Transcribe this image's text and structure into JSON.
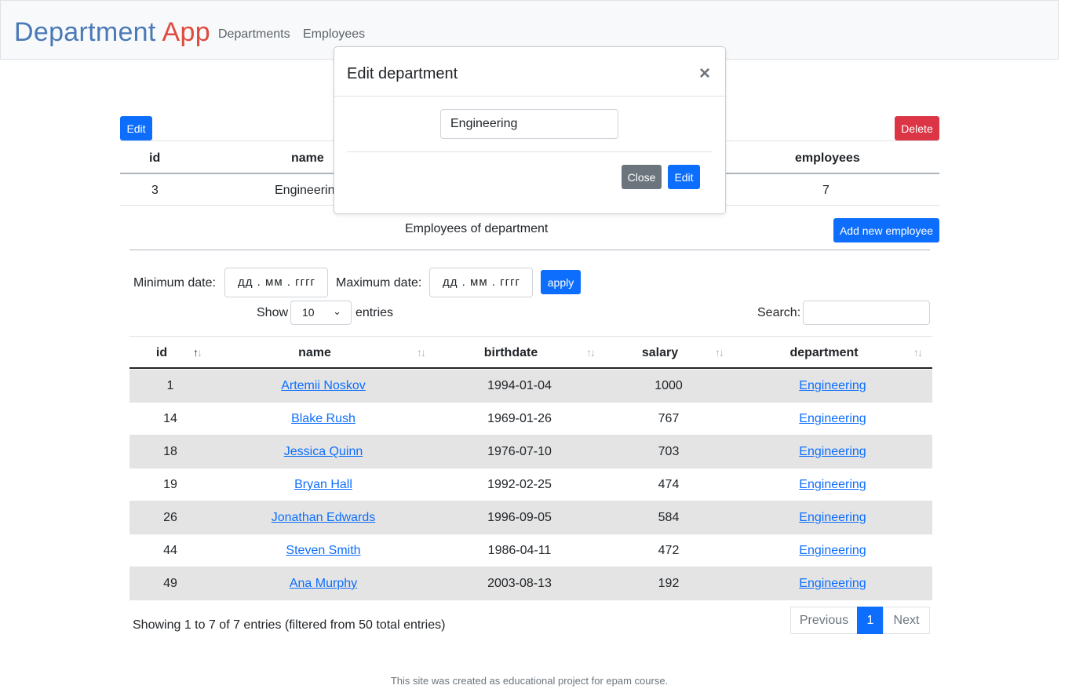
{
  "navbar": {
    "brand_part1": "Department",
    "brand_part2": "App",
    "links": [
      "Departments",
      "Employees"
    ]
  },
  "department": {
    "edit_label": "Edit",
    "delete_label": "Delete",
    "headers": {
      "id": "id",
      "name": "name",
      "employees": "employees"
    },
    "row": {
      "id": "3",
      "name": "Engineering",
      "employees": "7"
    }
  },
  "employees_section": {
    "caption": "Employees of department",
    "add_button": "Add new employee",
    "min_date_label": "Minimum date:",
    "max_date_label": "Maximum date:",
    "date_placeholder": "дд . мм . гггг",
    "apply_label": "apply",
    "show_label": "Show",
    "entries_value": "10",
    "entries_label": "entries",
    "search_label": "Search:"
  },
  "employees_table": {
    "headers": [
      "id",
      "name",
      "birthdate",
      "salary",
      "department"
    ],
    "rows": [
      {
        "id": "1",
        "name": "Artemii Noskov",
        "birthdate": "1994-01-04",
        "salary": "1000",
        "department": "Engineering"
      },
      {
        "id": "14",
        "name": "Blake Rush",
        "birthdate": "1969-01-26",
        "salary": "767",
        "department": "Engineering"
      },
      {
        "id": "18",
        "name": "Jessica Quinn",
        "birthdate": "1976-07-10",
        "salary": "703",
        "department": "Engineering"
      },
      {
        "id": "19",
        "name": "Bryan Hall",
        "birthdate": "1992-02-25",
        "salary": "474",
        "department": "Engineering"
      },
      {
        "id": "26",
        "name": "Jonathan Edwards",
        "birthdate": "1996-09-05",
        "salary": "584",
        "department": "Engineering"
      },
      {
        "id": "44",
        "name": "Steven Smith",
        "birthdate": "1986-04-11",
        "salary": "472",
        "department": "Engineering"
      },
      {
        "id": "49",
        "name": "Ana Murphy",
        "birthdate": "2003-08-13",
        "salary": "192",
        "department": "Engineering"
      }
    ],
    "info": "Showing 1 to 7 of 7 entries (filtered from 50 total entries)",
    "pagination": {
      "previous": "Previous",
      "current": "1",
      "next": "Next"
    }
  },
  "footer": "This site was created as educational project for epam course.",
  "modal": {
    "title": "Edit department",
    "close_icon": "×",
    "input_value": "Engineering",
    "close_label": "Close",
    "edit_label": "Edit"
  }
}
